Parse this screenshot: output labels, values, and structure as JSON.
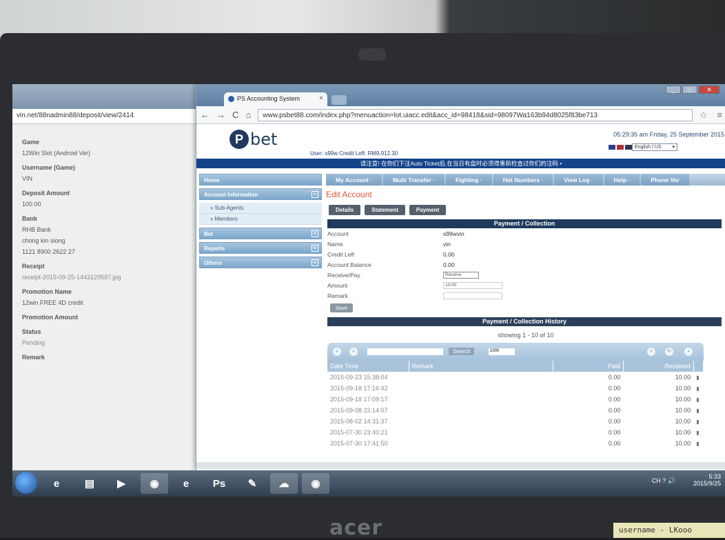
{
  "back_window": {
    "url": "vin.net/88nadmin88/deposit/view/2414",
    "fields": [
      {
        "label": "Game",
        "value": "12Win Slot (Android Ver)"
      },
      {
        "label": "Username (Game)",
        "value": "VIN"
      },
      {
        "label": "Deposit Amount",
        "value": "100.00"
      },
      {
        "label": "Bank",
        "value": "RHB Bank"
      },
      {
        "label": "",
        "value": "chong kin siong"
      },
      {
        "label": "",
        "value": "1121 8900 2622 27"
      },
      {
        "label": "Receipt",
        "value": "receipt-2015-09-25-1443129597.jpg"
      },
      {
        "label": "Promotion Name",
        "value": "12win FREE 4D credit"
      },
      {
        "label": "Promotion Amount",
        "value": ""
      },
      {
        "label": "Status",
        "value": "Pending"
      },
      {
        "label": "Remark",
        "value": ""
      }
    ]
  },
  "browser": {
    "tab_title": "PS Accounting System",
    "url": "www.psbet88.com/index.php?menuaction=lot.uiacc.edit&acc_id=98418&sid=98097Wa163b94d8025f83be713",
    "win_controls": [
      "_",
      "□",
      "✕"
    ]
  },
  "site": {
    "logo_letter": "P",
    "logo_text": "bet",
    "user_line": "User: s99w   Credit Left: RM9,912.30",
    "datetime": "05:29:35 am Friday, 25 September 2015",
    "language": "English / US",
    "notice": "请注意! 在你们下注Auto Ticket后,在当日有盘时必须得重新检查过你们的注码 •"
  },
  "sidebar": {
    "home": "Home",
    "account_info": "Account Information",
    "account_items": [
      "Sub-Agents",
      "Members"
    ],
    "bet": "Bet",
    "reports": "Reports",
    "others": "Others"
  },
  "menu": [
    "My Account ·",
    "Multi Transfer ·",
    "Fighting ·",
    "Hot Numbers ·",
    "View Log ·",
    "Help ·",
    "Phone Ver"
  ],
  "edit": {
    "title": "Edit Account",
    "subtabs": [
      "Details",
      "Statement",
      "Payment"
    ],
    "section_title": "Payment / Collection",
    "rows": [
      {
        "label": "Account",
        "value": "s99wvin"
      },
      {
        "label": "Name",
        "value": "vin"
      },
      {
        "label": "Credit Left",
        "value": "0.00"
      },
      {
        "label": "Account Balance",
        "value": "0.00"
      }
    ],
    "receive_label": "Receive/Pay",
    "receive_value": "Receive",
    "amount_label": "Amount",
    "amount_value": "10.00",
    "remark_label": "Remark",
    "save_label": "Save"
  },
  "history": {
    "title": "Payment / Collection History",
    "showing": "showing 1 - 10 of 10",
    "search_label": "Search",
    "page_size": "1000",
    "columns": [
      "Date Time",
      "Remark",
      "Paid",
      "Received"
    ],
    "rows": [
      {
        "dt": "2015-09-23 15:38:04",
        "remark": "",
        "paid": "0.00",
        "received": "10.00"
      },
      {
        "dt": "2015-09-18 17:16:42",
        "remark": "",
        "paid": "0.00",
        "received": "10.00"
      },
      {
        "dt": "2015-09-18 17:09:17",
        "remark": "",
        "paid": "0.00",
        "received": "10.00"
      },
      {
        "dt": "2015-09-08 22:14:07",
        "remark": "",
        "paid": "0.00",
        "received": "10.00"
      },
      {
        "dt": "2015-08-02 14:31:37",
        "remark": "",
        "paid": "0.00",
        "received": "10.00"
      },
      {
        "dt": "2015-07-30 23:40:21",
        "remark": "",
        "paid": "0.00",
        "received": "10.00"
      },
      {
        "dt": "2015-07-30 17:41:50",
        "remark": "",
        "paid": "0.00",
        "received": "10.00"
      }
    ]
  },
  "taskbar": {
    "lang": "CH",
    "time": "5:33",
    "date": "2015/9/25"
  },
  "device": {
    "brand": "acer",
    "note": "username - LKooo"
  }
}
